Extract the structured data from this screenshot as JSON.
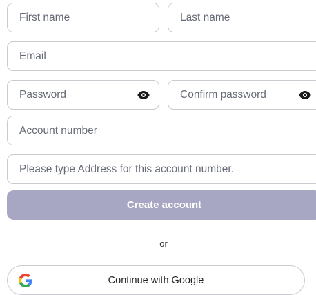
{
  "form": {
    "first_name": {
      "placeholder": "First name",
      "value": ""
    },
    "last_name": {
      "placeholder": "Last name",
      "value": ""
    },
    "email": {
      "placeholder": "Email",
      "value": ""
    },
    "password": {
      "placeholder": "Password",
      "value": ""
    },
    "confirm_password": {
      "placeholder": "Confirm password",
      "value": ""
    },
    "account_number": {
      "placeholder": "Account number",
      "value": ""
    },
    "address": {
      "placeholder": "Please type Address for this account number.",
      "value": ""
    },
    "create_label": "Create account"
  },
  "divider": {
    "text": "or"
  },
  "google": {
    "label": "Continue with Google"
  },
  "icons": {
    "password_toggle": "eye-icon",
    "confirm_toggle": "eye-icon",
    "google": "google-logo-icon"
  },
  "colors": {
    "create_button_bg": "#a8a7c3",
    "field_border": "#c9cbd1"
  }
}
